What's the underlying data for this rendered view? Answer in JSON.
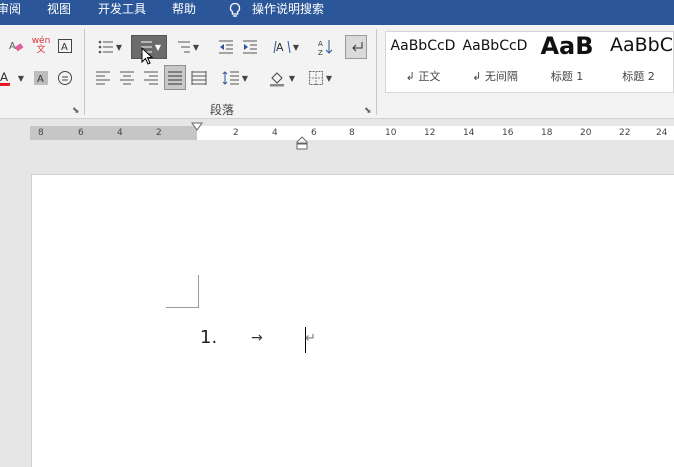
{
  "menu": {
    "items": [
      "审阅",
      "视图",
      "开发工具",
      "帮助"
    ],
    "tellme": "操作说明搜索"
  },
  "ribbon": {
    "group_label": "段落",
    "phonetic_glyph": "wén\n文",
    "styles": [
      {
        "sample": "AaBbCcD",
        "name": "↲ 正文"
      },
      {
        "sample": "AaBbCcD",
        "name": "↲ 无间隔"
      },
      {
        "sample": "AaB",
        "name": "标题 1"
      },
      {
        "sample": "AaBbC",
        "name": "标题 2"
      }
    ]
  },
  "ruler": {
    "left_ticks": [
      "8",
      "6",
      "4",
      "2"
    ],
    "right_ticks": [
      "2",
      "4",
      "6",
      "8",
      "10",
      "12",
      "14",
      "16",
      "18",
      "20",
      "22",
      "24"
    ]
  },
  "document": {
    "list_number": "1.",
    "tab_glyph": "→",
    "para_mark": "↵"
  },
  "colors": {
    "title_bar": "#2b579a",
    "font_color": "#e81123",
    "selected_button": "#6b6b6b"
  }
}
